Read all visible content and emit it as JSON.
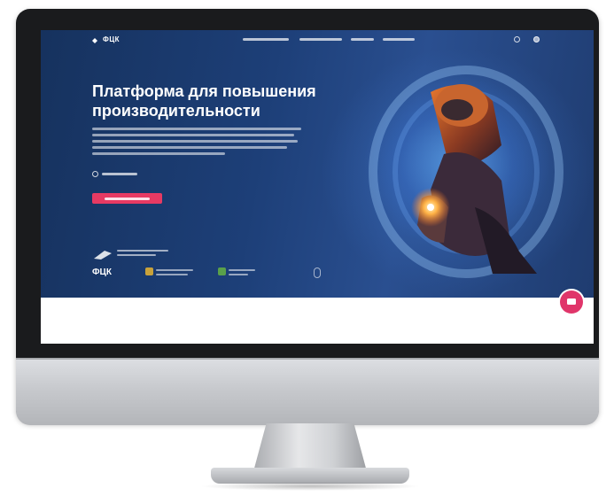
{
  "site": {
    "logo_text": "ФЦК"
  },
  "hero": {
    "title": "Платформа для повышения производительности"
  },
  "partners": {
    "fcc_logo": "ФЦК"
  },
  "colors": {
    "hero_bg": "#1d3f78",
    "accent": "#e73a63",
    "bezel": "#1a1b1d"
  },
  "icons": {
    "logo": "diamond-logo-icon",
    "search": "search-icon",
    "account": "user-icon",
    "play": "play-icon",
    "chat": "chat-icon",
    "scroll": "mouse-scroll-icon"
  }
}
